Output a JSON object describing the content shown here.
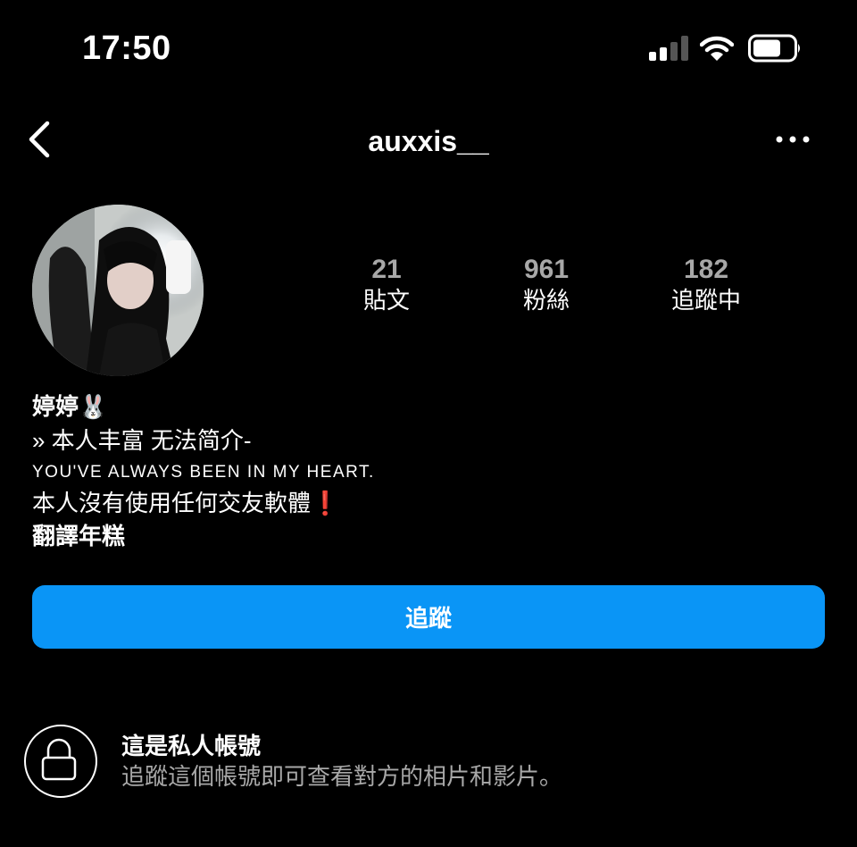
{
  "status_bar": {
    "time": "17:50",
    "signal_bars": 4,
    "signal_active_bars": 2
  },
  "nav": {
    "username": "auxxis__"
  },
  "stats": [
    {
      "count": "21",
      "label": "貼文"
    },
    {
      "count": "961",
      "label": "粉絲"
    },
    {
      "count": "182",
      "label": "追蹤中"
    }
  ],
  "bio": {
    "name": "婷婷",
    "name_emoji": "🐰",
    "line1": "» 本人丰富 无法简介-",
    "line2": "YOU'VE ALWAYS BEEN IN MY HEART.",
    "line3": "本人沒有使用任何交友軟體",
    "line3_emoji": "❗",
    "translate": "翻譯年糕"
  },
  "follow_button": {
    "label": "追蹤",
    "color": "#0a95f6"
  },
  "private": {
    "title": "這是私人帳號",
    "subtitle": "追蹤這個帳號即可查看對方的相片和影片。"
  }
}
